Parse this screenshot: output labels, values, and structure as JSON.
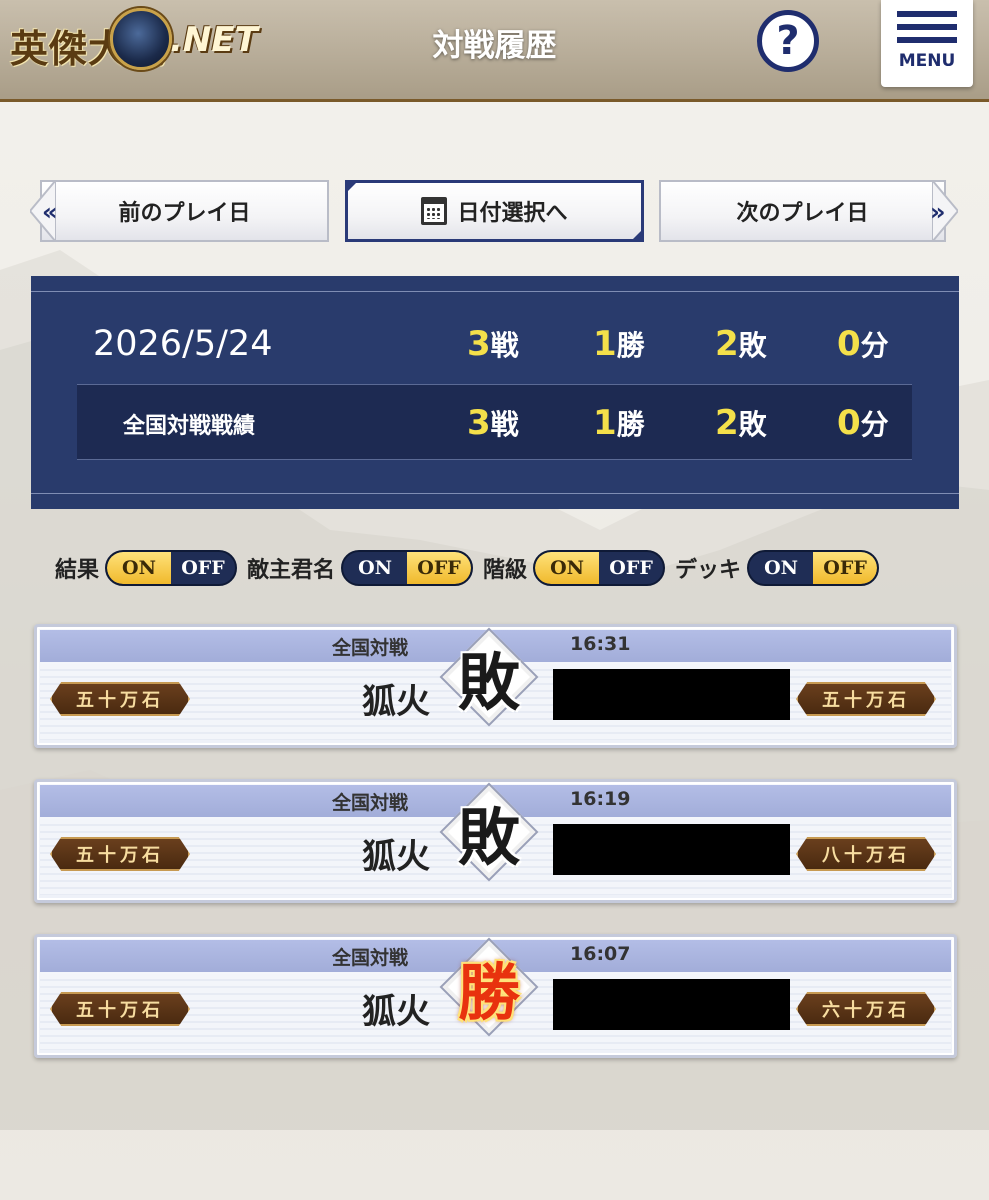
{
  "header": {
    "logo_text": "英傑大戦",
    "logo_net": ".NET",
    "title": "対戦履歴",
    "help_icon": "?",
    "menu_label": "MENU"
  },
  "nav": {
    "prev_label": "前のプレイ日",
    "select_label": "日付選択へ",
    "next_label": "次のプレイ日"
  },
  "record": {
    "date": "2026/5/24",
    "daily": {
      "battles": "3",
      "battles_unit": "戦",
      "wins": "1",
      "wins_unit": "勝",
      "losses": "2",
      "losses_unit": "敗",
      "draws": "0",
      "draws_unit": "分"
    },
    "national_label": "全国対戦戦績",
    "national": {
      "battles": "3",
      "battles_unit": "戦",
      "wins": "1",
      "wins_unit": "勝",
      "losses": "2",
      "losses_unit": "敗",
      "draws": "0",
      "draws_unit": "分"
    }
  },
  "toggles": [
    {
      "label": "結果",
      "on": "ON",
      "off": "OFF",
      "state": "on"
    },
    {
      "label": "敵主君名",
      "on": "ON",
      "off": "OFF",
      "state": "off"
    },
    {
      "label": "階級",
      "on": "ON",
      "off": "OFF",
      "state": "on"
    },
    {
      "label": "デッキ",
      "on": "ON",
      "off": "OFF",
      "state": "off"
    }
  ],
  "battles": [
    {
      "mode": "全国対戦",
      "time": "16:31",
      "player": "狐火",
      "result": "敗",
      "my_rank": "五十万石",
      "opp_rank": "五十万石"
    },
    {
      "mode": "全国対戦",
      "time": "16:19",
      "player": "狐火",
      "result": "敗",
      "my_rank": "五十万石",
      "opp_rank": "八十万石"
    },
    {
      "mode": "全国対戦",
      "time": "16:07",
      "player": "狐火",
      "result": "勝",
      "my_rank": "五十万石",
      "opp_rank": "六十万石"
    }
  ],
  "colors": {
    "navy": "#293b6c",
    "accent_yellow": "#f4e04a",
    "win_red": "#e8320e"
  }
}
